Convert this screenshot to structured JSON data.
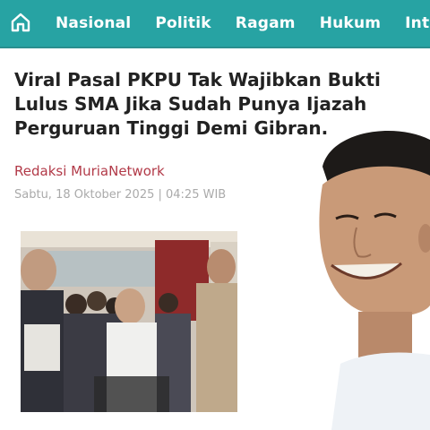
{
  "nav": {
    "items": [
      "Nasional",
      "Politik",
      "Ragam",
      "Hukum",
      "Inter"
    ]
  },
  "article": {
    "headline_lines": [
      "Viral Pasal PKPU Tak Wajibkan Bukti",
      "Lulus SMA Jika Sudah Punya Ijazah",
      "Perguruan Tinggi Demi Gibran."
    ],
    "author": "Redaksi MuriaNetwork",
    "date": "Sabtu, 18 Oktober 2025 | 04:25 WIB"
  },
  "colors": {
    "nav_bg": "#27a3a3",
    "author": "#b23a48",
    "date": "#aaaaaa",
    "headline": "#222222"
  }
}
